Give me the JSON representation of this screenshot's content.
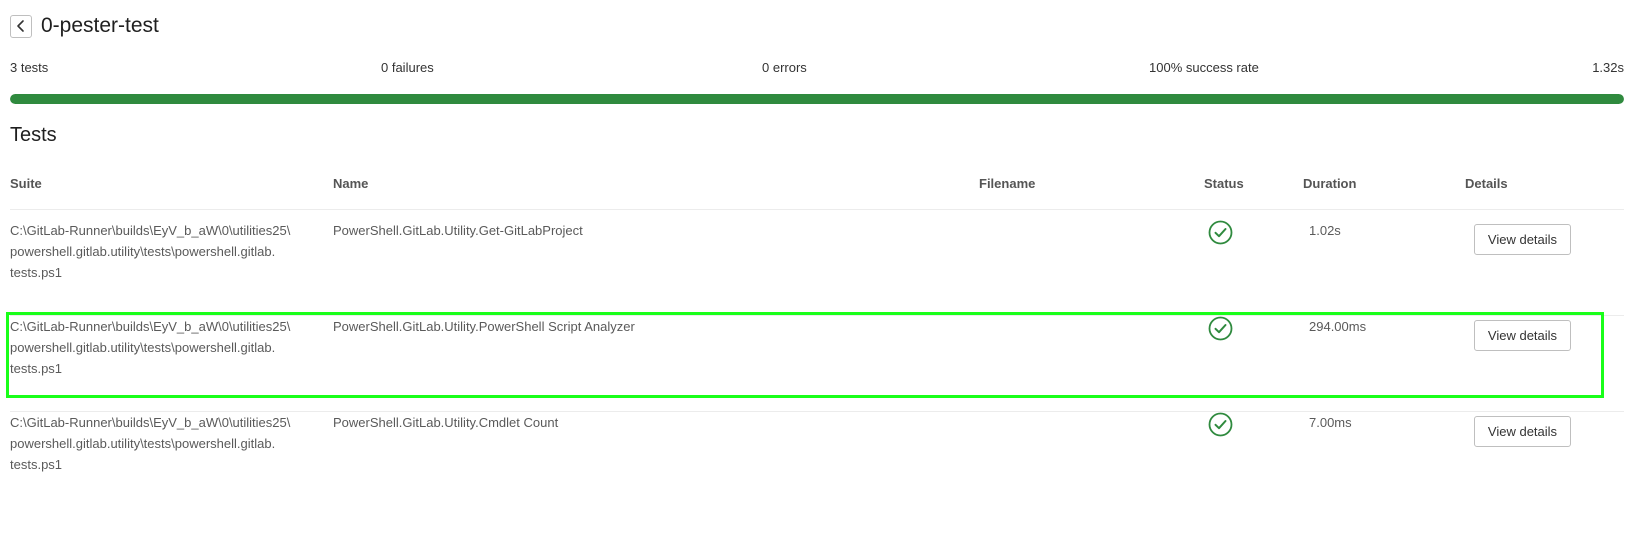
{
  "page": {
    "title": "0-pester-test",
    "back_icon": "chevron-left-icon"
  },
  "summary": {
    "tests": "3 tests",
    "failures": "0 failures",
    "errors": "0 errors",
    "success_rate": "100% success rate",
    "duration": "1.32s",
    "success_fraction": 1.0,
    "progress_color": "#2f8a3e"
  },
  "tests_section": {
    "title": "Tests",
    "columns": {
      "suite": "Suite",
      "name": "Name",
      "filename": "Filename",
      "status": "Status",
      "duration": "Duration",
      "details": "Details"
    },
    "rows": [
      {
        "suite_lines": [
          "C:\\GitLab-Runner\\builds\\EyV_b_aW\\0\\utilities25\\",
          "powershell.gitlab.utility\\tests\\powershell.gitlab.",
          "tests.ps1"
        ],
        "name": "PowerShell.GitLab.Utility.Get-GitLabProject",
        "filename": "",
        "status_icon": "check-circle-icon",
        "duration": "1.02s",
        "details_label": "View details"
      },
      {
        "suite_lines": [
          "C:\\GitLab-Runner\\builds\\EyV_b_aW\\0\\utilities25\\",
          "powershell.gitlab.utility\\tests\\powershell.gitlab.",
          "tests.ps1"
        ],
        "name": "PowerShell.GitLab.Utility.PowerShell Script Analyzer",
        "filename": "",
        "status_icon": "check-circle-icon",
        "duration": "294.00ms",
        "details_label": "View details"
      },
      {
        "suite_lines": [
          "C:\\GitLab-Runner\\builds\\EyV_b_aW\\0\\utilities25\\",
          "powershell.gitlab.utility\\tests\\powershell.gitlab.",
          "tests.ps1"
        ],
        "name": "PowerShell.GitLab.Utility.Cmdlet Count",
        "filename": "",
        "status_icon": "check-circle-icon",
        "duration": "7.00ms",
        "details_label": "View details"
      }
    ]
  },
  "colors": {
    "success": "#2f8a3e",
    "highlight": "#19ff19"
  }
}
